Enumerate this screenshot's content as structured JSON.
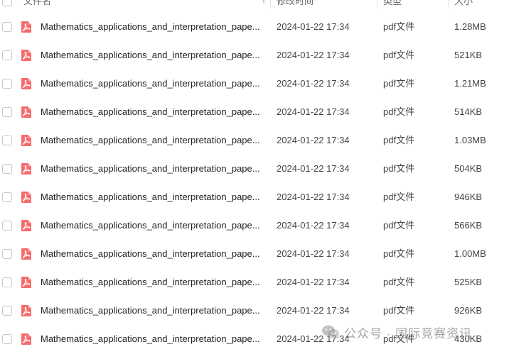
{
  "header": {
    "name": "文件名",
    "modified": "修改时间",
    "type": "类型",
    "size": "大小",
    "sort_icon": "arrow-up-icon"
  },
  "files": [
    {
      "name": "Mathematics_applications_and_interpretation_pape...",
      "date": "2024-01-22 17:34",
      "type": "pdf文件",
      "size": "1.28MB"
    },
    {
      "name": "Mathematics_applications_and_interpretation_pape...",
      "date": "2024-01-22 17:34",
      "type": "pdf文件",
      "size": "521KB"
    },
    {
      "name": "Mathematics_applications_and_interpretation_pape...",
      "date": "2024-01-22 17:34",
      "type": "pdf文件",
      "size": "1.21MB"
    },
    {
      "name": "Mathematics_applications_and_interpretation_pape...",
      "date": "2024-01-22 17:34",
      "type": "pdf文件",
      "size": "514KB"
    },
    {
      "name": "Mathematics_applications_and_interpretation_pape...",
      "date": "2024-01-22 17:34",
      "type": "pdf文件",
      "size": "1.03MB"
    },
    {
      "name": "Mathematics_applications_and_interpretation_pape...",
      "date": "2024-01-22 17:34",
      "type": "pdf文件",
      "size": "504KB"
    },
    {
      "name": "Mathematics_applications_and_interpretation_pape...",
      "date": "2024-01-22 17:34",
      "type": "pdf文件",
      "size": "946KB"
    },
    {
      "name": "Mathematics_applications_and_interpretation_pape...",
      "date": "2024-01-22 17:34",
      "type": "pdf文件",
      "size": "566KB"
    },
    {
      "name": "Mathematics_applications_and_interpretation_pape...",
      "date": "2024-01-22 17:34",
      "type": "pdf文件",
      "size": "1.00MB"
    },
    {
      "name": "Mathematics_applications_and_interpretation_pape...",
      "date": "2024-01-22 17:34",
      "type": "pdf文件",
      "size": "525KB"
    },
    {
      "name": "Mathematics_applications_and_interpretation_pape...",
      "date": "2024-01-22 17:34",
      "type": "pdf文件",
      "size": "926KB"
    },
    {
      "name": "Mathematics_applications_and_interpretation_pape...",
      "date": "2024-01-22 17:34",
      "type": "pdf文件",
      "size": "430KB"
    }
  ],
  "file_icon": "pdf-icon",
  "colors": {
    "pdf_icon": "#f56c6c",
    "sort_accent": "#3a8ee6"
  },
  "watermark": {
    "text": "公众号 · 国际竞赛资讯",
    "icon": "wechat-icon"
  }
}
